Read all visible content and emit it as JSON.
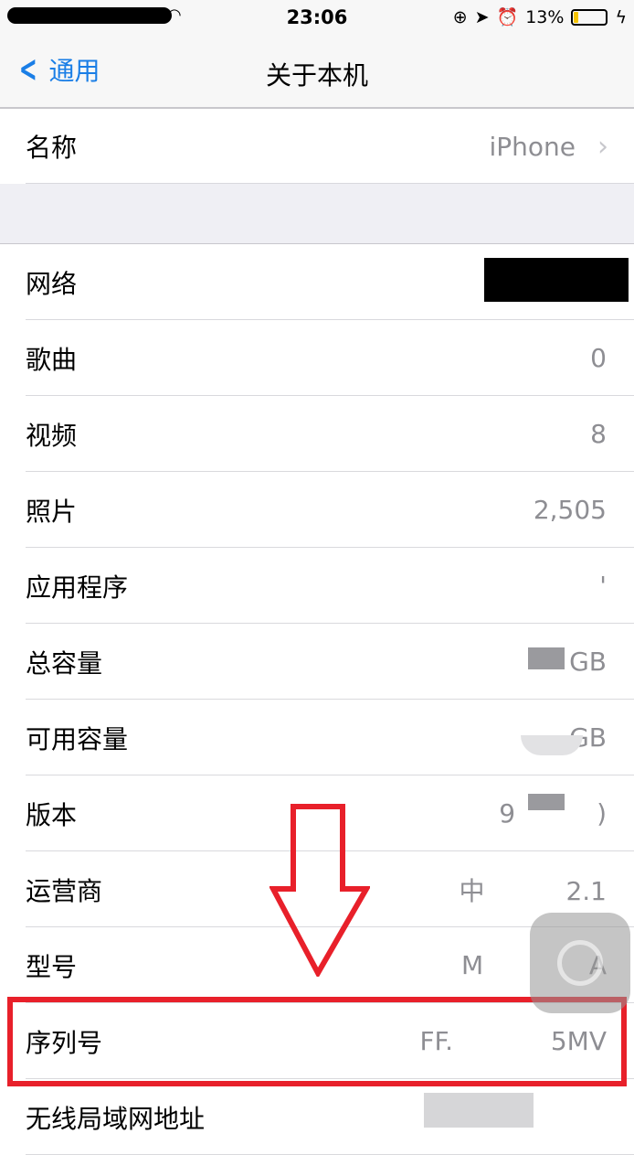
{
  "status_bar": {
    "time": "23:06",
    "battery": "13%",
    "battery_level": 0.13,
    "battery_color": "#f5c400"
  },
  "nav": {
    "back_label": "通用",
    "title": "关于本机"
  },
  "name_row": {
    "label": "名称",
    "value": "iPhone"
  },
  "rows": [
    {
      "label": "网络",
      "value": ""
    },
    {
      "label": "歌曲",
      "value": "0"
    },
    {
      "label": "视频",
      "value": "8"
    },
    {
      "label": "照片",
      "value": "2,505"
    },
    {
      "label": "应用程序",
      "value": "'"
    },
    {
      "label": "总容量",
      "value": "GB"
    },
    {
      "label": "可用容量",
      "value": "GB"
    },
    {
      "label": "版本",
      "value": "9          )"
    },
    {
      "label": "运营商",
      "value": "中          2.1"
    },
    {
      "label": "型号",
      "value": "M             A"
    },
    {
      "label": "序列号",
      "value": "FF.            5MV"
    },
    {
      "label": "无线局域网地址",
      "value": ""
    }
  ],
  "annotation_color": "#e8202a"
}
